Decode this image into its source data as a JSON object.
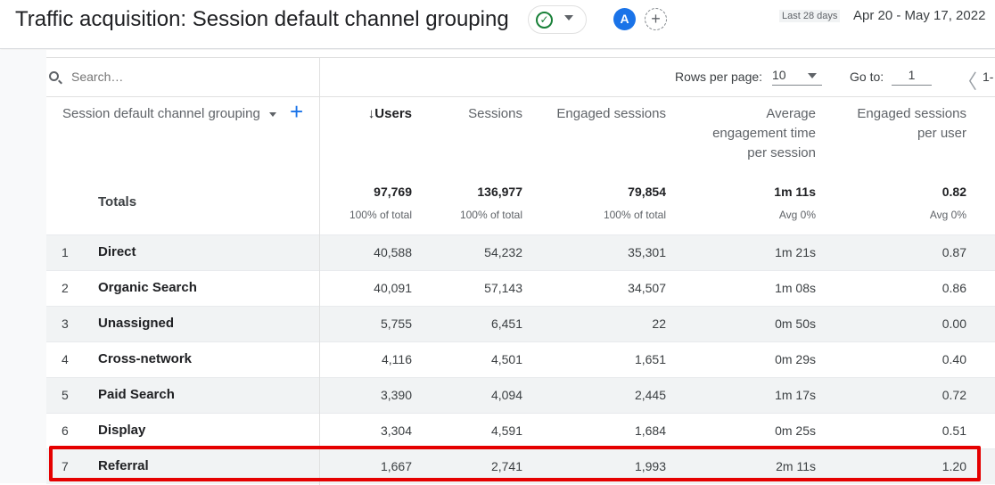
{
  "header": {
    "title": "Traffic acquisition: Session default channel grouping",
    "avatar_letter": "A",
    "add_comparison": "+",
    "date_range_label": "Last 28 days",
    "date_range": "Apr 20 - May 17, 2022"
  },
  "toolbar": {
    "search_placeholder": "Search…",
    "rows_per_page_label": "Rows per page:",
    "rows_per_page": "10",
    "goto_label": "Go to:",
    "goto_value": "1",
    "page_info": "1-"
  },
  "table": {
    "dimension_header": "Session default channel grouping",
    "columns": [
      "↓Users",
      "Sessions",
      "Engaged sessions",
      "Average\nengagement time\nper session",
      "Engaged sessions\nper user"
    ],
    "totals_label": "Totals",
    "totals": [
      {
        "value": "97,769",
        "sub": "100% of total"
      },
      {
        "value": "136,977",
        "sub": "100% of total"
      },
      {
        "value": "79,854",
        "sub": "100% of total"
      },
      {
        "value": "1m 11s",
        "sub": "Avg 0%"
      },
      {
        "value": "0.82",
        "sub": "Avg 0%"
      }
    ],
    "rows": [
      {
        "idx": "1",
        "name": "Direct",
        "cells": [
          "40,588",
          "54,232",
          "35,301",
          "1m 21s",
          "0.87"
        ]
      },
      {
        "idx": "2",
        "name": "Organic Search",
        "cells": [
          "40,091",
          "57,143",
          "34,507",
          "1m 08s",
          "0.86"
        ]
      },
      {
        "idx": "3",
        "name": "Unassigned",
        "cells": [
          "5,755",
          "6,451",
          "22",
          "0m 50s",
          "0.00"
        ]
      },
      {
        "idx": "4",
        "name": "Cross-network",
        "cells": [
          "4,116",
          "4,501",
          "1,651",
          "0m 29s",
          "0.40"
        ]
      },
      {
        "idx": "5",
        "name": "Paid Search",
        "cells": [
          "3,390",
          "4,094",
          "2,445",
          "1m 17s",
          "0.72"
        ]
      },
      {
        "idx": "6",
        "name": "Display",
        "cells": [
          "3,304",
          "4,591",
          "1,684",
          "0m 25s",
          "0.51"
        ]
      },
      {
        "idx": "7",
        "name": "Referral",
        "cells": [
          "1,667",
          "2,741",
          "1,993",
          "2m 11s",
          "1.20"
        ]
      }
    ]
  },
  "colors": {
    "highlight": "#e50000",
    "accent": "#1a73e8",
    "status_ok": "#188038"
  }
}
